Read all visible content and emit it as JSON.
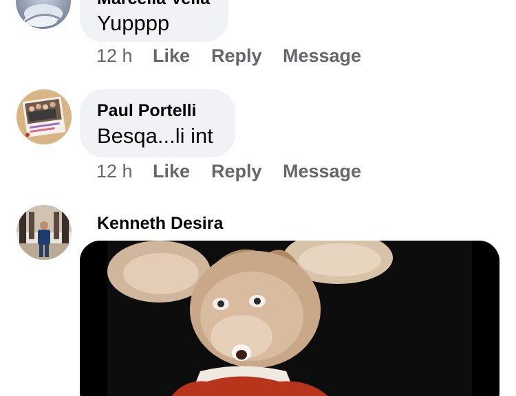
{
  "comments": [
    {
      "author": "Marcella Vella",
      "text": "Yupppp",
      "time": "12 h",
      "actions": [
        "Like",
        "Reply",
        "Message"
      ]
    },
    {
      "author": "Paul Portelli",
      "text": "Besqa...li int",
      "time": "12 h",
      "actions": [
        "Like",
        "Reply",
        "Message"
      ]
    },
    {
      "author": "Kenneth Desira",
      "attachment": "gif"
    }
  ],
  "colors": {
    "bubble": "#f0f2f5",
    "text": "#050505",
    "secondary_text": "#65676b"
  }
}
